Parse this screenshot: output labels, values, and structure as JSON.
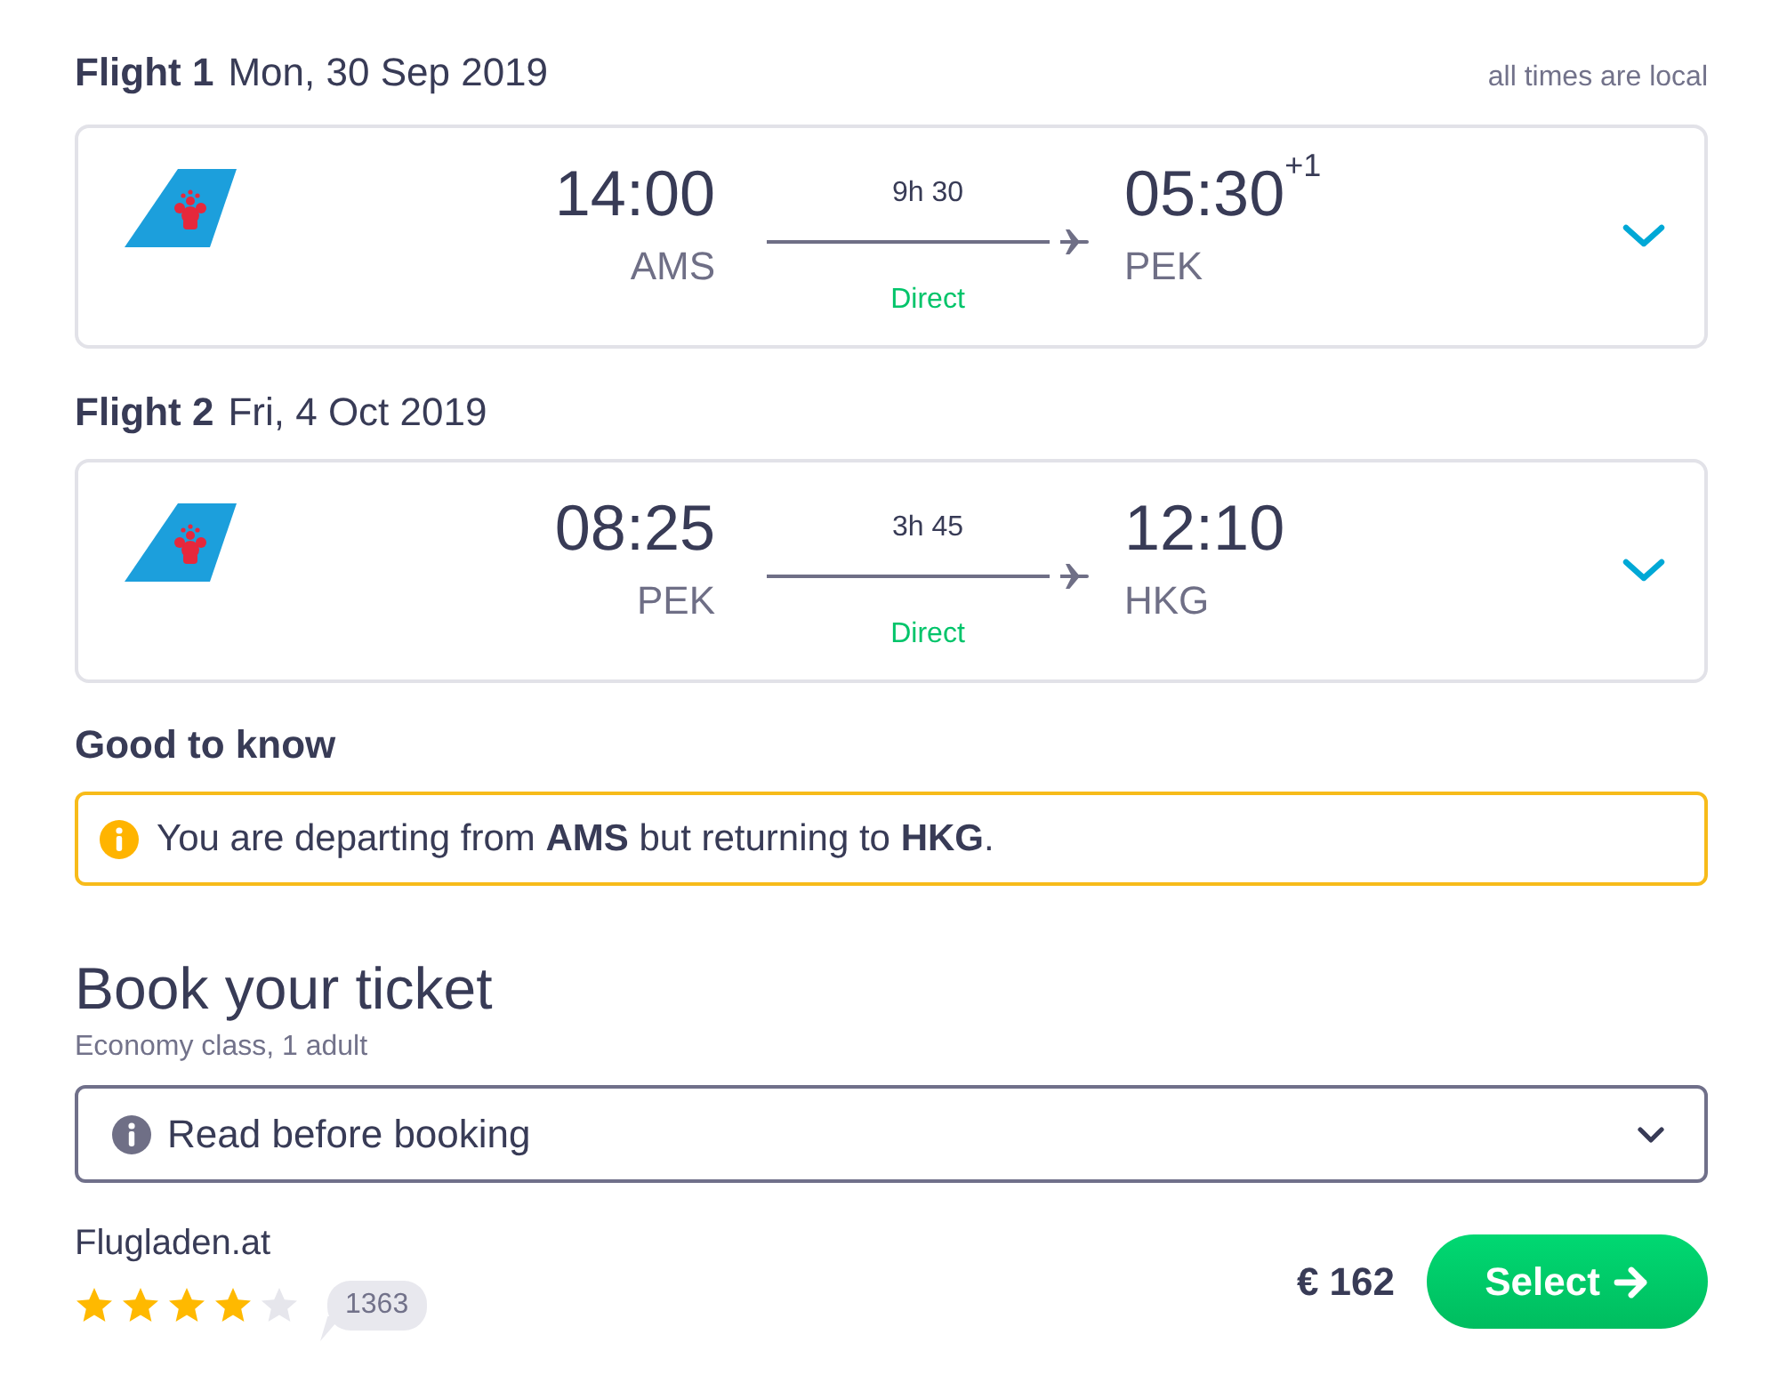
{
  "flights": [
    {
      "label": "Flight 1",
      "date": "Mon, 30 Sep 2019",
      "note": "all times are local",
      "departure": {
        "time": "14:00",
        "airport": "AMS"
      },
      "duration": "9h 30",
      "stops": "Direct",
      "arrival": {
        "time": "05:30",
        "day_offset": "+1",
        "airport": "PEK"
      }
    },
    {
      "label": "Flight 2",
      "date": "Fri, 4 Oct 2019",
      "departure": {
        "time": "08:25",
        "airport": "PEK"
      },
      "duration": "3h 45",
      "stops": "Direct",
      "arrival": {
        "time": "12:10",
        "airport": "HKG"
      }
    }
  ],
  "good_to_know": {
    "title": "Good to know",
    "notice": "You are departing from **AMS** but returning to **HKG**."
  },
  "booking": {
    "title": "Book your ticket",
    "subtitle": "Economy class, 1 adult",
    "info_dropdown": "Read before booking",
    "provider": {
      "name": "Flugladen.at",
      "stars": 4,
      "review_count": "1363",
      "price": "€ 162",
      "select_button": "Select"
    }
  }
}
